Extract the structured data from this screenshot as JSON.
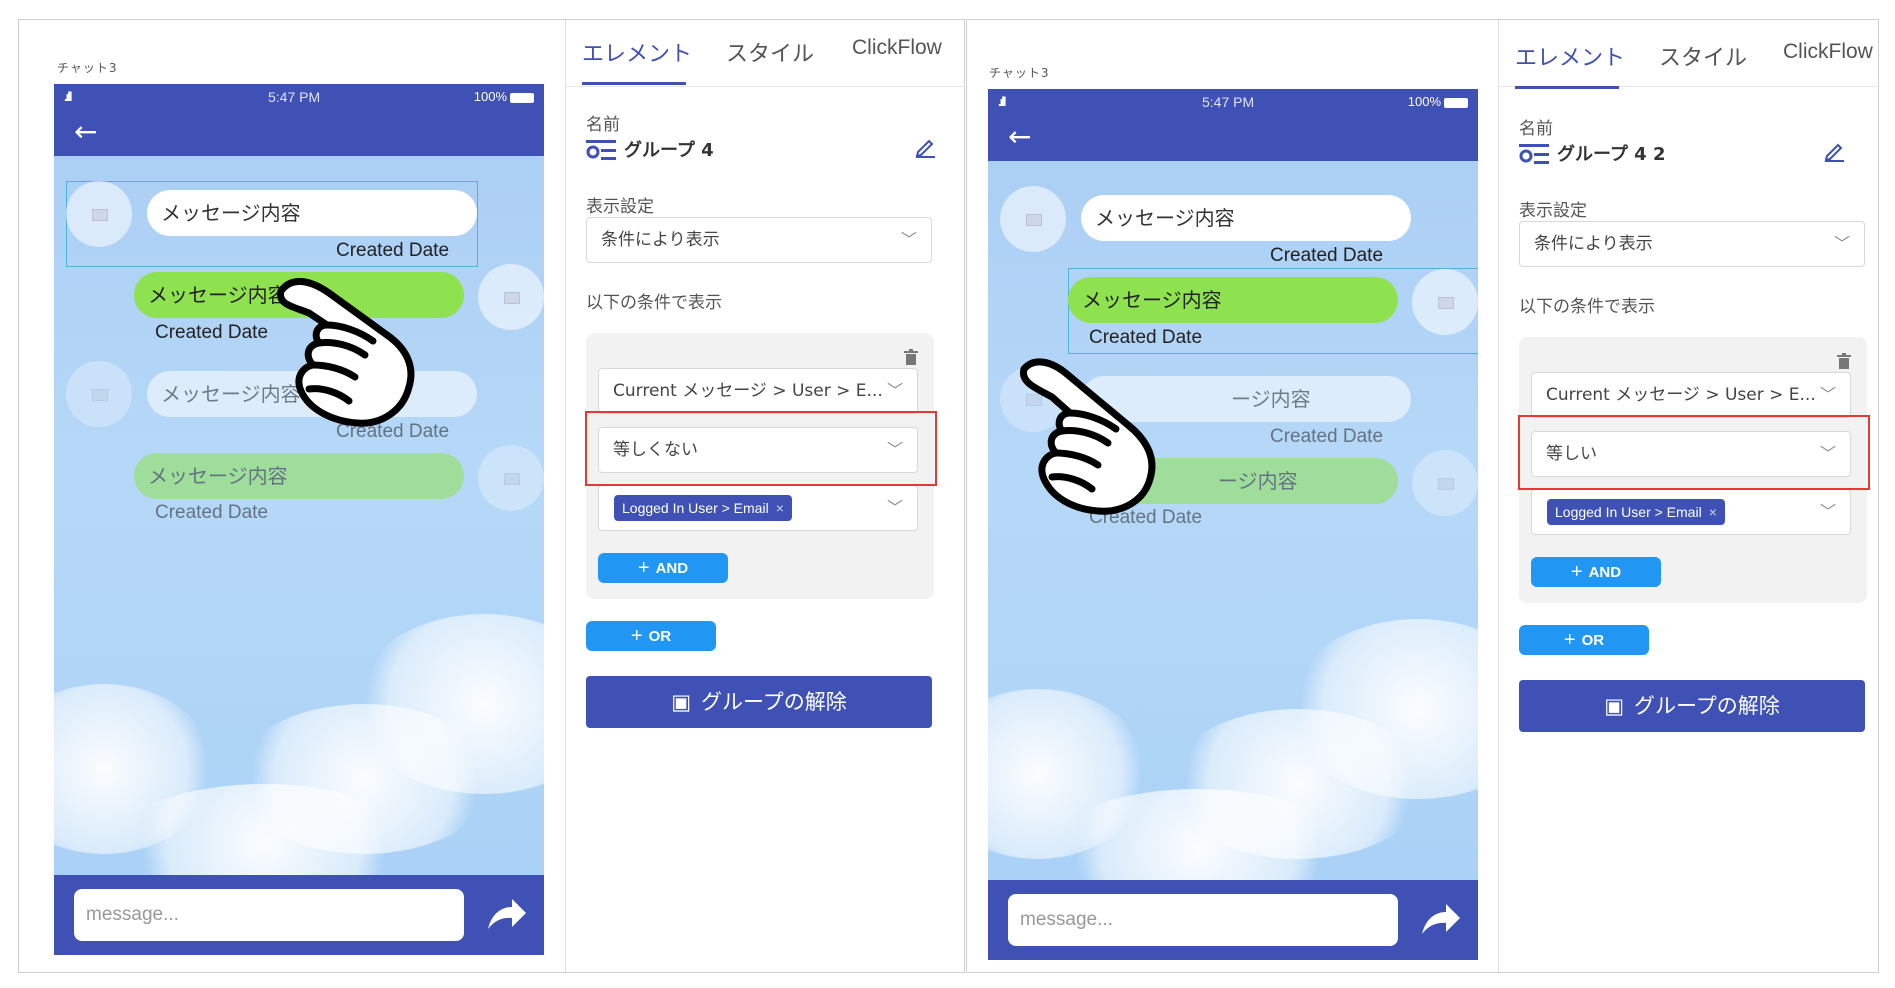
{
  "left": {
    "screen_label": "チャット3",
    "status": {
      "time": "5:47 PM",
      "battery": "100%"
    },
    "messages": [
      {
        "text": "メッセージ内容",
        "date": "Created Date"
      },
      {
        "text": "メッセージ内容",
        "date": "Created Date"
      },
      {
        "text": "メッセージ内容",
        "date": "Created Date"
      },
      {
        "text": "メッセージ内容",
        "date": "Created Date"
      }
    ],
    "input_placeholder": "message...",
    "tabs": [
      "エレメント",
      "スタイル",
      "ClickFlow"
    ],
    "name_label": "名前",
    "group_name": "グループ 4",
    "display_label": "表示設定",
    "display_value": "条件により表示",
    "condition_label": "以下の条件で表示",
    "cond_field": "Current メッセージ > User > E...",
    "cond_operator": "等しくない",
    "cond_value_chip": "Logged In User > Email",
    "and_label": "AND",
    "or_label": "OR",
    "ungroup_label": "グループの解除",
    "ungroup_icon": "▣"
  },
  "right": {
    "screen_label": "チャット3",
    "status": {
      "time": "5:47 PM",
      "battery": "100%"
    },
    "messages": [
      {
        "text": "メッセージ内容",
        "date": "Created Date"
      },
      {
        "text": "メッセージ内容",
        "date": "Created Date"
      },
      {
        "text": "ージ内容",
        "date": "Created Date"
      },
      {
        "text": "ージ内容",
        "date": "Created Date"
      }
    ],
    "input_placeholder": "message...",
    "tabs": [
      "エレメント",
      "スタイル",
      "ClickFlow"
    ],
    "name_label": "名前",
    "group_name": "グループ 4 2",
    "display_label": "表示設定",
    "display_value": "条件により表示",
    "condition_label": "以下の条件で表示",
    "cond_field": "Current メッセージ > User > E...",
    "cond_operator": "等しい",
    "cond_value_chip": "Logged In User > Email",
    "and_label": "AND",
    "or_label": "OR",
    "ungroup_label": "グループの解除",
    "ungroup_icon": "▣"
  },
  "icons": {
    "back": "←",
    "chevron": "﹀",
    "remove": "×",
    "plus": "+"
  },
  "colors": {
    "primary": "#3f51b5",
    "accent_button": "#2196f3",
    "own_bubble": "#8ee24f",
    "highlight_box": "#e53935"
  }
}
